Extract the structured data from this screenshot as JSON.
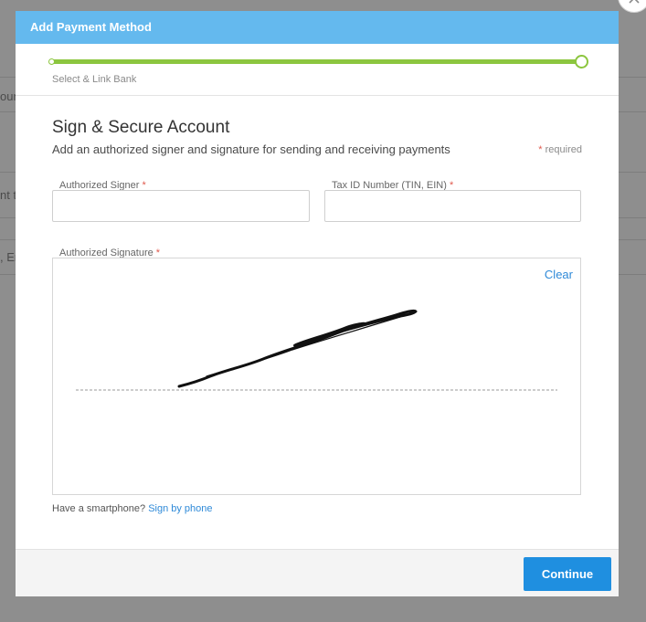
{
  "background": {
    "fragments": [
      "oun",
      "nt t",
      ", En"
    ]
  },
  "modal": {
    "title": "Add Payment Method",
    "progress": {
      "step_label": "Select & Link Bank",
      "value": 1.0
    },
    "section": {
      "title": "Sign & Secure Account",
      "description": "Add an authorized signer and signature for sending and receiving payments",
      "required_note": "required",
      "required_marker": "*"
    },
    "fields": {
      "authorized_signer": {
        "label": "Authorized Signer",
        "value": "",
        "placeholder": ""
      },
      "tax_id": {
        "label": "Tax ID Number (TIN, EIN)",
        "value": "",
        "placeholder": ""
      }
    },
    "signature": {
      "label": "Authorized Signature",
      "clear_label": "Clear"
    },
    "phone": {
      "prompt": "Have a smartphone?",
      "link_label": "Sign by phone"
    },
    "footer": {
      "continue_label": "Continue"
    }
  },
  "colors": {
    "header": "#64b9ee",
    "progress": "#8cc63f",
    "primary_button": "#1f8fe0",
    "link": "#2f8ad8",
    "required": "#e05a4e"
  },
  "icons": {
    "close": "close-icon"
  }
}
